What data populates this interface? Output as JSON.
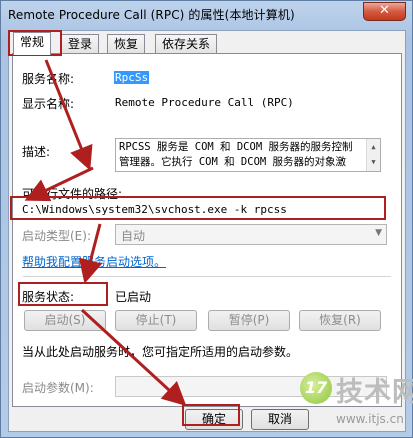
{
  "window": {
    "title": "Remote Procedure Call (RPC) 的属性(本地计算机)",
    "close_label": "✕"
  },
  "tabs": [
    {
      "label": "常规",
      "active": true
    },
    {
      "label": "登录"
    },
    {
      "label": "恢复"
    },
    {
      "label": "依存关系"
    }
  ],
  "general": {
    "service_name_label": "服务名称:",
    "service_name_value": "RpcSs",
    "display_name_label": "显示名称:",
    "display_name_value": "Remote Procedure Call (RPC)",
    "description_label": "描述:",
    "description_line1": "RPCSS 服务是 COM 和 DCOM 服务器的服务控制",
    "description_line2": "管理器。它执行 COM 和 DCOM 服务器的对象激",
    "exe_path_label": "可执行文件的路径:",
    "exe_path_value": "C:\\Windows\\system32\\svchost.exe -k rpcss",
    "startup_type_label": "启动类型(E):",
    "startup_type_value": "自动",
    "help_link": "帮助我配置服务启动选项。",
    "service_status_label": "服务状态:",
    "service_status_value": "已启动",
    "buttons": {
      "start": "启动(S)",
      "stop": "停止(T)",
      "pause": "暂停(P)",
      "resume": "恢复(R)"
    },
    "start_params_note": "当从此处启动服务时，您可指定所适用的启动参数。",
    "start_params_label": "启动参数(M):"
  },
  "footer": {
    "ok": "确定",
    "cancel": "取消"
  },
  "watermark": {
    "logo_text": "17",
    "brand": "技术网",
    "url": "www.itjs.cn"
  },
  "colors": {
    "annotation_red": "#b01f1f",
    "link_blue": "#0066cc",
    "selection_blue": "#3399ff"
  }
}
